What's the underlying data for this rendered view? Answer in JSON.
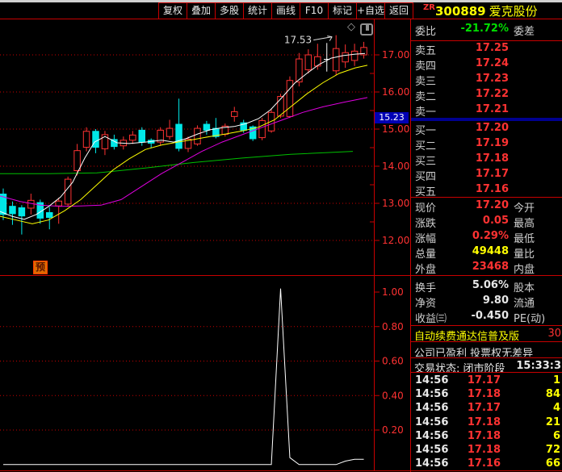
{
  "toolbar": {
    "buttons": [
      "复权",
      "叠加",
      "多股",
      "统计",
      "画线",
      "F10",
      "标记",
      "+自选",
      "返回"
    ],
    "stock_prefix": "ZR",
    "stock_code": "300889",
    "stock_name": "爱克股份"
  },
  "colors": {
    "up": "#ff3232",
    "down": "#00e8e8",
    "doji": "#ffffff",
    "ma_white": "#ffffff",
    "ma_yellow": "#ffff00",
    "ma_magenta": "#e000e0",
    "ma_green": "#00c000",
    "grid": "#c80000",
    "axis_text": "#ff3232",
    "badge_bg": "#0000b4",
    "label": "#cfcfcf",
    "red": "#ff3232",
    "yellow": "#ffff00",
    "green": "#00dd00",
    "white": "#e8e8e8",
    "indicator_line": "#ffffff",
    "annotation": "#dddddd"
  },
  "chart_data": {
    "type": "candlestick",
    "title": "爱克股份 300889 K线图",
    "y_axis": {
      "ticks": [
        17.0,
        16.0,
        15.0,
        14.0,
        13.0,
        12.0
      ],
      "badge": "15.23"
    },
    "peak_annotation": {
      "text": "17.53",
      "candle_index": 36
    },
    "signal_badge": "预",
    "candles": [
      [
        13.25,
        12.7,
        13.4,
        12.55
      ],
      [
        12.92,
        12.72,
        13.05,
        12.42
      ],
      [
        12.88,
        12.66,
        12.95,
        12.16
      ],
      [
        12.87,
        13.08,
        13.26,
        12.7
      ],
      [
        13.02,
        12.6,
        13.1,
        12.45
      ],
      [
        12.75,
        12.62,
        12.9,
        12.3
      ],
      [
        12.93,
        13.06,
        13.15,
        12.45
      ],
      [
        12.98,
        13.65,
        13.72,
        12.9
      ],
      [
        13.88,
        14.42,
        14.6,
        13.75
      ],
      [
        14.51,
        14.94,
        15.05,
        14.4
      ],
      [
        14.94,
        14.51,
        15.0,
        14.35
      ],
      [
        14.47,
        14.85,
        14.95,
        14.3
      ],
      [
        14.72,
        14.53,
        14.85,
        14.45
      ],
      [
        14.55,
        14.7,
        14.8,
        14.45
      ],
      [
        14.7,
        14.84,
        14.95,
        14.6
      ],
      [
        14.97,
        14.65,
        15.05,
        14.55
      ],
      [
        14.7,
        14.62,
        14.75,
        14.5
      ],
      [
        14.65,
        14.97,
        15.05,
        14.55
      ],
      [
        14.8,
        15.02,
        15.25,
        14.72
      ],
      [
        15.13,
        14.48,
        15.82,
        14.4
      ],
      [
        14.48,
        14.73,
        14.8,
        14.38
      ],
      [
        14.6,
        15.02,
        15.1,
        14.55
      ],
      [
        15.13,
        14.97,
        15.22,
        14.85
      ],
      [
        15.02,
        14.8,
        15.3,
        14.75
      ],
      [
        14.86,
        15.08,
        15.15,
        14.8
      ],
      [
        15.34,
        15.47,
        15.6,
        15.2
      ],
      [
        15.17,
        14.97,
        15.25,
        14.9
      ],
      [
        15.06,
        14.74,
        15.1,
        14.68
      ],
      [
        14.77,
        15.23,
        15.3,
        14.7
      ],
      [
        14.95,
        15.45,
        15.55,
        14.9
      ],
      [
        15.35,
        15.88,
        15.95,
        15.3
      ],
      [
        15.34,
        16.31,
        16.42,
        15.3
      ],
      [
        16.27,
        16.89,
        17.05,
        16.15
      ],
      [
        16.6,
        17.0,
        17.15,
        16.5
      ],
      [
        16.7,
        16.95,
        17.3,
        16.6
      ],
      [
        16.88,
        16.88,
        17.32,
        16.55
      ],
      [
        16.57,
        17.17,
        17.53,
        16.45
      ],
      [
        16.81,
        17.06,
        17.28,
        16.65
      ],
      [
        16.85,
        17.1,
        17.3,
        16.7
      ],
      [
        17.0,
        17.2,
        17.35,
        16.9
      ]
    ],
    "ma_lines": {
      "white": [
        [
          0,
          12.78
        ],
        [
          15,
          12.65
        ],
        [
          30,
          12.57
        ],
        [
          45,
          12.7
        ],
        [
          60,
          12.91
        ],
        [
          75,
          13.17
        ],
        [
          90,
          13.57
        ],
        [
          105,
          14.22
        ],
        [
          117,
          14.65
        ],
        [
          130,
          14.8
        ],
        [
          145,
          14.63
        ],
        [
          160,
          14.61
        ],
        [
          180,
          14.65
        ],
        [
          200,
          14.7
        ],
        [
          215,
          14.65
        ],
        [
          230,
          14.74
        ],
        [
          245,
          14.87
        ],
        [
          260,
          14.98
        ],
        [
          275,
          15.04
        ],
        [
          290,
          15.07
        ],
        [
          305,
          15.15
        ],
        [
          320,
          15.28
        ],
        [
          335,
          15.52
        ],
        [
          350,
          15.87
        ],
        [
          365,
          16.24
        ],
        [
          380,
          16.5
        ],
        [
          395,
          16.74
        ],
        [
          410,
          16.91
        ],
        [
          425,
          16.98
        ],
        [
          440,
          17.02
        ],
        [
          452,
          17.04
        ]
      ],
      "yellow": [
        [
          0,
          12.65
        ],
        [
          20,
          12.55
        ],
        [
          40,
          12.45
        ],
        [
          60,
          12.55
        ],
        [
          80,
          12.8
        ],
        [
          100,
          13.1
        ],
        [
          120,
          13.5
        ],
        [
          140,
          13.9
        ],
        [
          160,
          14.2
        ],
        [
          180,
          14.45
        ],
        [
          200,
          14.57
        ],
        [
          220,
          14.65
        ],
        [
          240,
          14.72
        ],
        [
          260,
          14.8
        ],
        [
          280,
          14.87
        ],
        [
          300,
          14.95
        ],
        [
          320,
          15.05
        ],
        [
          340,
          15.25
        ],
        [
          360,
          15.6
        ],
        [
          380,
          15.95
        ],
        [
          400,
          16.25
        ],
        [
          420,
          16.5
        ],
        [
          440,
          16.65
        ],
        [
          455,
          16.72
        ]
      ],
      "magenta": [
        [
          0,
          13.2
        ],
        [
          25,
          13.05
        ],
        [
          50,
          12.95
        ],
        [
          75,
          12.92
        ],
        [
          100,
          12.93
        ],
        [
          125,
          12.95
        ],
        [
          150,
          13.1
        ],
        [
          175,
          13.45
        ],
        [
          200,
          13.8
        ],
        [
          225,
          14.1
        ],
        [
          250,
          14.4
        ],
        [
          275,
          14.65
        ],
        [
          300,
          14.85
        ],
        [
          325,
          15.05
        ],
        [
          350,
          15.25
        ],
        [
          375,
          15.45
        ],
        [
          400,
          15.6
        ],
        [
          425,
          15.72
        ],
        [
          455,
          15.85
        ]
      ],
      "green": [
        [
          0,
          13.8
        ],
        [
          60,
          13.8
        ],
        [
          120,
          13.82
        ],
        [
          180,
          13.95
        ],
        [
          240,
          14.1
        ],
        [
          300,
          14.22
        ],
        [
          360,
          14.32
        ],
        [
          437,
          14.4
        ]
      ]
    },
    "indicator": {
      "ticks": [
        1.0,
        0.8,
        0.6,
        0.4,
        0.2
      ],
      "values": [
        0,
        0,
        0,
        0,
        0,
        0,
        0,
        0,
        0,
        0,
        0,
        0,
        0,
        0,
        0,
        0,
        0,
        0,
        0,
        0,
        0,
        0,
        0,
        0,
        0,
        0,
        0,
        0,
        0,
        0,
        1.02,
        0.04,
        0,
        0,
        0,
        0,
        0,
        0.02,
        0.03,
        0.03
      ]
    }
  },
  "order_book": {
    "weibi_label": "委比",
    "weibi_value": "-21.72%",
    "weicha_label": "委差",
    "sells": [
      {
        "label": "卖五",
        "price": "17.25"
      },
      {
        "label": "卖四",
        "price": "17.24"
      },
      {
        "label": "卖三",
        "price": "17.23"
      },
      {
        "label": "卖二",
        "price": "17.22"
      },
      {
        "label": "卖一",
        "price": "17.21"
      }
    ],
    "buys": [
      {
        "label": "买一",
        "price": "17.20"
      },
      {
        "label": "买二",
        "price": "17.19"
      },
      {
        "label": "买三",
        "price": "17.18"
      },
      {
        "label": "买四",
        "price": "17.17"
      },
      {
        "label": "买五",
        "price": "17.16"
      }
    ]
  },
  "info_rows": [
    {
      "label": "现价",
      "value": "17.20",
      "vc": "red",
      "label2": "今开"
    },
    {
      "label": "涨跌",
      "value": "0.05",
      "vc": "red",
      "label2": "最高"
    },
    {
      "label": "涨幅",
      "value": "0.29%",
      "vc": "red",
      "label2": "最低"
    },
    {
      "label": "总量",
      "value": "49448",
      "vc": "yellow",
      "label2": "量比"
    },
    {
      "label": "外盘",
      "value": "23468",
      "vc": "red",
      "label2": "内盘"
    }
  ],
  "info_rows2": [
    {
      "label": "换手",
      "value": "5.06%",
      "vc": "white",
      "label2": "股本"
    },
    {
      "label": "净资",
      "value": "9.80",
      "vc": "white",
      "label2": "流通"
    },
    {
      "label": "收益㈢",
      "value": "-0.450",
      "vc": "white",
      "label2": "PE(动)"
    }
  ],
  "notice": {
    "text": "自动续费通达信普及版",
    "suffix": "30"
  },
  "company_line": "公司已盈利 投票权无差异",
  "status": {
    "text": "交易状态: 闭市阶段",
    "time": "15:33:3"
  },
  "tick_list": [
    {
      "time": "14:56",
      "price": "17.17",
      "volume": "1"
    },
    {
      "time": "14:56",
      "price": "17.18",
      "volume": "84"
    },
    {
      "time": "14:56",
      "price": "17.17",
      "volume": "4"
    },
    {
      "time": "14:56",
      "price": "17.18",
      "volume": "21"
    },
    {
      "time": "14:56",
      "price": "17.18",
      "volume": "6"
    },
    {
      "time": "14:56",
      "price": "17.18",
      "volume": "72"
    },
    {
      "time": "14:56",
      "price": "17.16",
      "volume": "66"
    }
  ]
}
